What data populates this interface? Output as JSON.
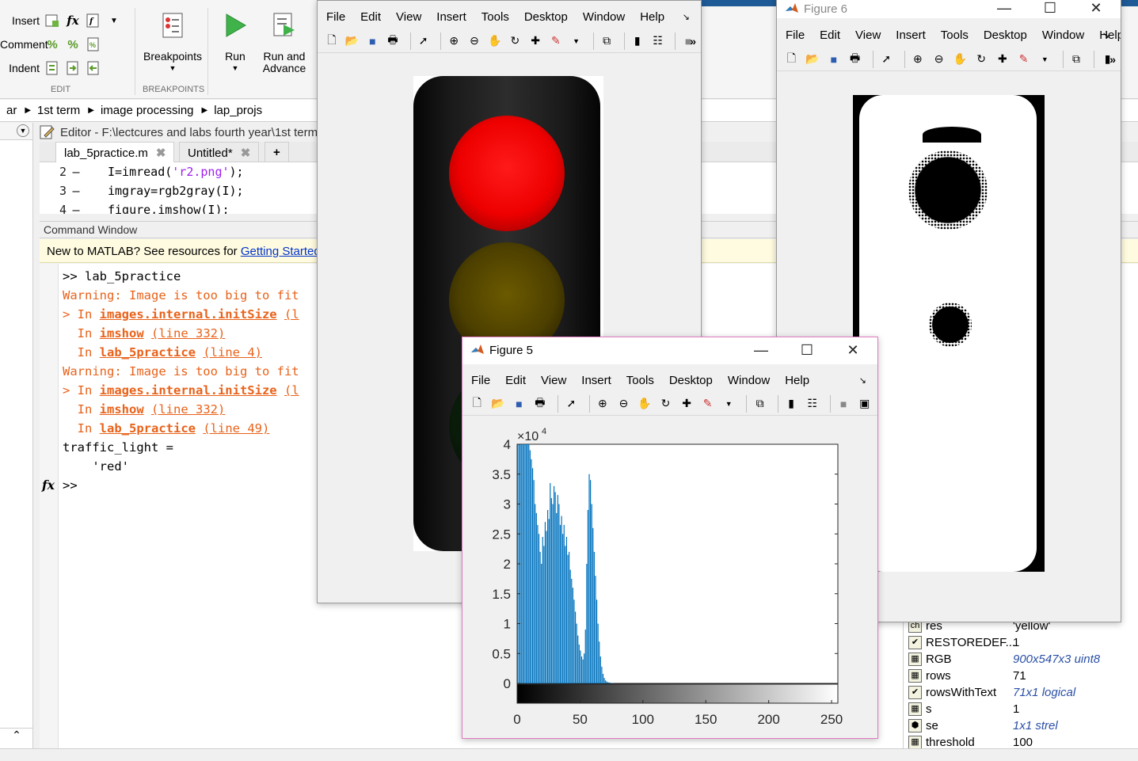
{
  "ribbon": {
    "rows": [
      {
        "label": "Insert",
        "icons": [
          "insert-section-icon",
          "fx-icon",
          "function-icon"
        ]
      },
      {
        "label": "Comment",
        "icons": [
          "comment-percent-icon",
          "uncomment-icon",
          "wrap-comment-icon"
        ]
      },
      {
        "label": "Indent",
        "icons": [
          "smart-indent-icon",
          "increase-indent-icon",
          "decrease-indent-icon"
        ]
      }
    ],
    "edit_group": "EDIT",
    "breakpoints_group": "BREAKPOINTS",
    "breakpoints_label": "Breakpoints",
    "run_label": "Run",
    "run_advance_label": "Run and\nAdvance"
  },
  "address": {
    "crumbs": [
      "ar",
      "1st term",
      "image processing",
      "lap_projs"
    ]
  },
  "editor": {
    "title": "Editor - F:\\lectcures and labs fourth year\\1st term",
    "tabs": [
      "lab_5practice.m",
      "Untitled*"
    ],
    "add_tab": "+",
    "lines": [
      {
        "n": "2",
        "pre": "I=imread(",
        "str": "'r2.png'",
        "post": ");"
      },
      {
        "n": "3",
        "pre": "imgray=rgb2gray(I);",
        "str": "",
        "post": ""
      },
      {
        "n": "4",
        "pre": "figure,imshow(I);",
        "str": "",
        "post": ""
      }
    ]
  },
  "command_window": {
    "title": "Command Window",
    "banner_text": "New to MATLAB? See resources for ",
    "banner_link": "Getting Started",
    "banner_end": ".",
    "prompt_cmd": ">> lab_5practice",
    "warning1": "Warning: Image is too big to fit",
    "warning2": "Warning: Image is too big to fit",
    "stack1": {
      "prefix": "> In ",
      "fn": "images.internal.initSize",
      "tail": "(l"
    },
    "stack2": {
      "prefix": "  In ",
      "fn": "imshow",
      "tail": "(line 332)"
    },
    "stack3": {
      "prefix": "  In ",
      "fn": "lab_5practice",
      "tail": "(line 4)"
    },
    "stack4": {
      "prefix": "> In ",
      "fn": "images.internal.initSize",
      "tail": "(l"
    },
    "stack5": {
      "prefix": "  In ",
      "fn": "imshow",
      "tail": "(line 332)"
    },
    "stack6": {
      "prefix": "  In ",
      "fn": "lab_5practice",
      "tail": "(line 49)"
    },
    "var_name": "traffic_light =",
    "var_value": "    'red'",
    "fx": "fx",
    "prompt": ">>"
  },
  "workspace": {
    "rows": [
      {
        "name": "res",
        "value": "'yellow'",
        "italic": false
      },
      {
        "name": "RESTOREDEF...",
        "value": "1",
        "italic": false
      },
      {
        "name": "RGB",
        "value": "900x547x3 uint8",
        "italic": true
      },
      {
        "name": "rows",
        "value": "71",
        "italic": false
      },
      {
        "name": "rowsWithText",
        "value": "71x1 logical",
        "italic": true
      },
      {
        "name": "s",
        "value": "1",
        "italic": false
      },
      {
        "name": "se",
        "value": "1x1 strel",
        "italic": true
      },
      {
        "name": "threshold",
        "value": "100",
        "italic": false
      }
    ]
  },
  "figure_menu": [
    "File",
    "Edit",
    "View",
    "Insert",
    "Tools",
    "Desktop",
    "Window",
    "Help"
  ],
  "figure6_title": "Figure 6",
  "figure5_title": "Figure 5",
  "chart_data": {
    "type": "bar",
    "title": "",
    "xlabel": "",
    "ylabel": "",
    "xlim": [
      0,
      255
    ],
    "ylim": [
      0,
      40000
    ],
    "y_exponent_label": "×10",
    "y_exponent_power": "4",
    "yticks": [
      "0",
      "0.5",
      "1",
      "1.5",
      "2",
      "2.5",
      "3",
      "3.5",
      "4"
    ],
    "xticks": [
      "0",
      "50",
      "100",
      "150",
      "200",
      "250"
    ],
    "x": [
      0,
      1,
      2,
      3,
      4,
      5,
      6,
      7,
      8,
      9,
      10,
      11,
      12,
      13,
      14,
      15,
      16,
      17,
      18,
      19,
      20,
      21,
      22,
      23,
      24,
      25,
      26,
      27,
      28,
      29,
      30,
      31,
      32,
      33,
      34,
      35,
      36,
      37,
      38,
      39,
      40,
      41,
      42,
      43,
      44,
      45,
      46,
      47,
      48,
      49,
      50,
      51,
      52,
      53,
      54,
      55,
      56,
      57,
      58,
      59,
      60,
      61,
      62,
      63,
      64,
      65,
      66,
      67,
      68,
      69,
      70,
      71,
      72,
      73,
      74,
      75,
      76,
      77,
      78,
      79,
      80,
      81,
      82,
      83,
      84,
      85
    ],
    "values": [
      40000,
      40000,
      40000,
      40000,
      40000,
      40000,
      40000,
      40000,
      40000,
      40000,
      39000,
      37500,
      36000,
      34000,
      30000,
      28500,
      26500,
      25000,
      22000,
      20000,
      24500,
      23000,
      27000,
      25500,
      29000,
      27500,
      33500,
      31000,
      30000,
      33000,
      32000,
      28500,
      31500,
      30000,
      26500,
      28000,
      25000,
      26500,
      23000,
      24500,
      21500,
      22000,
      19000,
      17500,
      16000,
      14000,
      12000,
      10000,
      8000,
      6500,
      5500,
      4500,
      4000,
      5000,
      9000,
      20000,
      29000,
      35000,
      34000,
      30000,
      26000,
      22000,
      18000,
      14000,
      10000,
      7000,
      4500,
      2800,
      1600,
      900,
      500,
      300,
      200,
      150,
      100,
      60,
      40,
      20,
      10,
      5,
      3,
      2,
      1,
      1,
      0,
      0
    ]
  }
}
